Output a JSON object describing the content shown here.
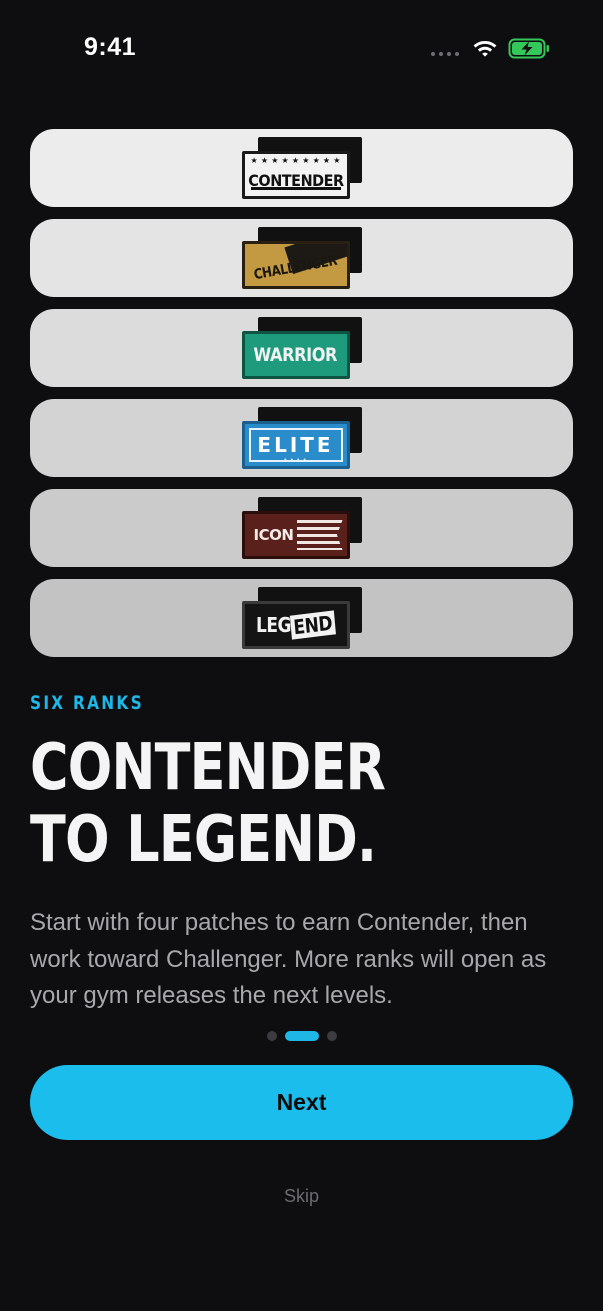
{
  "status_bar": {
    "time": "9:41",
    "battery_color": "#34c759"
  },
  "ranks": [
    {
      "label": "CONTENDER",
      "card_color": "#ececec"
    },
    {
      "label": "CHALLENGER",
      "card_color": "#e4e4e4"
    },
    {
      "label": "WARRIOR",
      "card_color": "#dcdcdc"
    },
    {
      "label": "ELITE",
      "card_color": "#d3d3d3"
    },
    {
      "label": "ICON",
      "card_color": "#cbcbcb"
    },
    {
      "label": "LEGEND",
      "card_color": "#c3c3c3",
      "label_start": "LEG",
      "label_end": "END"
    }
  ],
  "onboarding": {
    "eyebrow": "SIX RANKS",
    "headline_line1": "CONTENDER",
    "headline_line2": "TO LEGEND.",
    "body": "Start with four patches to earn Contender, then work toward Challenger. More ranks will open as your gym releases the next levels.",
    "page_current": 2,
    "page_total": 3
  },
  "actions": {
    "next_label": "Next",
    "skip_label": "Skip"
  },
  "colors": {
    "accent": "#1bbdec",
    "background": "#0e0e10"
  }
}
